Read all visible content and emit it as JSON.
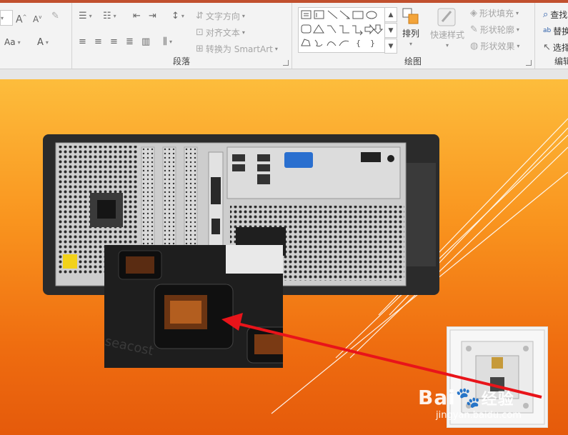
{
  "ribbon": {
    "font": {
      "aa_label": "Aa",
      "a_label": "A"
    },
    "paragraph": {
      "group_label": "段落",
      "text_direction": "文字方向",
      "align_text": "对齐文本",
      "convert_smartart": "转换为 SmartArt"
    },
    "drawing": {
      "group_label": "绘图",
      "arrange": "排列",
      "quick_styles": "快速样式",
      "shape_fill": "形状填充",
      "shape_outline": "形状轮廓",
      "shape_effects": "形状效果"
    },
    "editing": {
      "group_label": "编辑",
      "find": "查找",
      "replace": "替换",
      "select": "选择"
    }
  },
  "watermark": {
    "brand": "Bai",
    "brand_cn": "经验",
    "url": "jingyan.baidu.com"
  },
  "colors": {
    "accent": "#c1502e",
    "arrow": "#e8141a",
    "slide_top": "#fdbd3c",
    "slide_bottom": "#e55a0b"
  }
}
